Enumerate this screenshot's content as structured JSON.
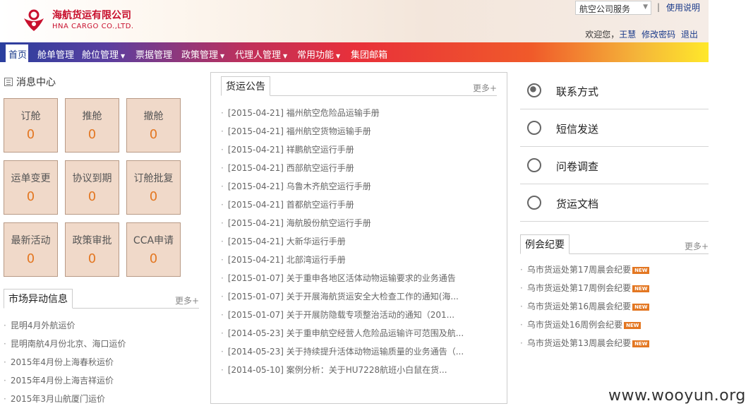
{
  "header": {
    "logo_cn": "海航货运有限公司",
    "logo_en": "HNA CARGO CO.,LTD.",
    "service_select": "航空公司服务",
    "help_link": "使用说明",
    "welcome_text": "欢迎您，",
    "username": "王慧",
    "change_password": "修改密码",
    "logout": "退出"
  },
  "nav": {
    "home": "首页",
    "items": [
      {
        "label": "舱单管理",
        "dropdown": false
      },
      {
        "label": "舱位管理",
        "dropdown": true
      },
      {
        "label": "票据管理",
        "dropdown": false
      },
      {
        "label": "政策管理",
        "dropdown": true
      },
      {
        "label": "代理人管理",
        "dropdown": true
      },
      {
        "label": "常用功能",
        "dropdown": true
      },
      {
        "label": "集团邮箱",
        "dropdown": false
      }
    ],
    "caret": "▼"
  },
  "message_center": {
    "title": "消息中心",
    "tiles": [
      {
        "label": "订舱",
        "count": "0"
      },
      {
        "label": "推舱",
        "count": "0"
      },
      {
        "label": "撤舱",
        "count": "0"
      },
      {
        "label": "运单变更",
        "count": "0"
      },
      {
        "label": "协议到期",
        "count": "0"
      },
      {
        "label": "订舱批复",
        "count": "0"
      },
      {
        "label": "最新活动",
        "count": "0"
      },
      {
        "label": "政策审批",
        "count": "0"
      },
      {
        "label": "CCA申请",
        "count": "0"
      }
    ]
  },
  "market": {
    "title": "市场异动信息",
    "more": "更多+",
    "items": [
      "昆明4月外航运价",
      "昆明南航4月份北京、海口运价",
      "2015年4月份上海春秋运价",
      "2015年4月份上海吉祥运价",
      "2015年3月山航厦门运价"
    ]
  },
  "announcements": {
    "title": "货运公告",
    "more": "更多+",
    "items": [
      "[2015-04-21] 福州航空危险品运输手册",
      "[2015-04-21] 福州航空货物运输手册",
      "[2015-04-21] 祥鹏航空运行手册",
      "[2015-04-21] 西部航空运行手册",
      "[2015-04-21] 乌鲁木齐航空运行手册",
      "[2015-04-21] 首都航空运行手册",
      "[2015-04-21] 海航股份航空运行手册",
      "[2015-04-21] 大新华运行手册",
      "[2015-04-21] 北部湾运行手册",
      "[2015-01-07] 关于重申各地区活体动物运输要求的业务通告",
      "[2015-01-07] 关于开展海航货运安全大检查工作的通知(海...",
      "[2015-01-07] 关于开展防隐载专项整治活动的通知（201...",
      "[2014-05-23] 关于重申航空经营人危险品运输许可范围及航...",
      "[2014-05-23] 关于持续提升活体动物运输质量的业务通告（...",
      "[2014-05-10] 案例分析：关于HU7228航班小白鼠在货..."
    ]
  },
  "contacts": [
    {
      "label": "联系方式",
      "icon": "globe-icon"
    },
    {
      "label": "短信发送",
      "icon": "user-chat-icon"
    },
    {
      "label": "问卷调查",
      "icon": "arrow-circle-icon"
    },
    {
      "label": "货运文档",
      "icon": "arrow-circle-icon"
    }
  ],
  "meetings": {
    "title": "例会纪要",
    "more": "更多+",
    "new_badge": "NEW",
    "items": [
      "乌市货运处第17周晨会纪要",
      "乌市货运处第17周例会纪要",
      "乌市货运处第16周晨会纪要",
      "乌市货运处16周例会纪要",
      "乌市货运处第13周晨会纪要"
    ]
  },
  "watermark": "www.wooyun.org",
  "colors": {
    "brand_red": "#c8102e",
    "tile_bg": "#f0d9c9",
    "count_orange": "#e37722",
    "link_blue": "#1a3a8a"
  }
}
